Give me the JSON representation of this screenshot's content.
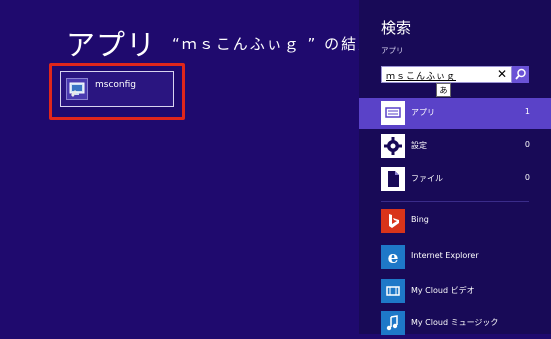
{
  "results": {
    "heading": "アプリ",
    "query_text": "“ｍｓこんふぃｇ ” の結果",
    "items": [
      {
        "label": "msconfig",
        "icon": "msconfig-app-icon"
      }
    ]
  },
  "search_pane": {
    "title": "検索",
    "scope_label": "アプリ",
    "query_value": "ｍｓこんふぃｇ",
    "clear_glyph": "✕",
    "ime_indicator": "あ",
    "categories": [
      {
        "label": "アプリ",
        "count": "1",
        "icon": "apps-icon",
        "selected": true
      },
      {
        "label": "設定",
        "count": "0",
        "icon": "settings-gear-icon",
        "selected": false
      },
      {
        "label": "ファイル",
        "count": "0",
        "icon": "file-icon",
        "selected": false
      }
    ],
    "apps": [
      {
        "label": "Bing",
        "icon": "bing-icon",
        "color": "#d9341a"
      },
      {
        "label": "Internet Explorer",
        "icon": "internet-explorer-icon",
        "color": "#1e78c8"
      },
      {
        "label": "My Cloud ビデオ",
        "icon": "video-icon",
        "color": "#1e78c8"
      },
      {
        "label": "My Cloud ミュージック",
        "icon": "music-icon",
        "color": "#1e78c8"
      }
    ]
  },
  "colors": {
    "background": "#1f0a6e",
    "pane_background": "#180a57",
    "selected_category": "#5a42c8",
    "highlight_box": "#e0261b"
  }
}
